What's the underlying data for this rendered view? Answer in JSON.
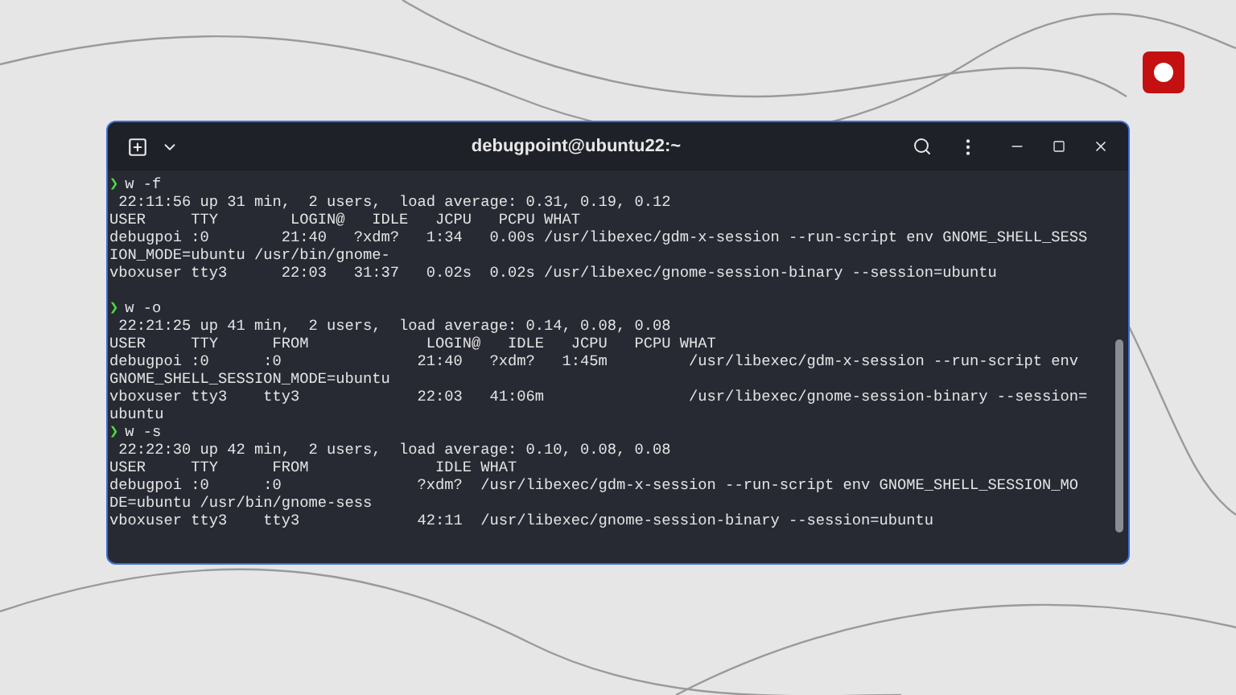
{
  "window": {
    "title": "debugpoint@ubuntu22:~"
  },
  "lines": [
    {
      "kind": "prompt",
      "symbol": "❯",
      "text": "w -f"
    },
    {
      "kind": "output",
      "text": " 22:11:56 up 31 min,  2 users,  load average: 0.31, 0.19, 0.12"
    },
    {
      "kind": "output",
      "text": "USER     TTY        LOGIN@   IDLE   JCPU   PCPU WHAT"
    },
    {
      "kind": "output",
      "text": "debugpoi :0        21:40   ?xdm?   1:34   0.00s /usr/libexec/gdm-x-session --run-script env GNOME_SHELL_SESS"
    },
    {
      "kind": "output",
      "text": "ION_MODE=ubuntu /usr/bin/gnome-"
    },
    {
      "kind": "output",
      "text": "vboxuser tty3      22:03   31:37   0.02s  0.02s /usr/libexec/gnome-session-binary --session=ubuntu"
    },
    {
      "kind": "blank"
    },
    {
      "kind": "prompt",
      "symbol": "❯",
      "text": "w -o"
    },
    {
      "kind": "output",
      "text": " 22:21:25 up 41 min,  2 users,  load average: 0.14, 0.08, 0.08"
    },
    {
      "kind": "output",
      "text": "USER     TTY      FROM             LOGIN@   IDLE   JCPU   PCPU WHAT"
    },
    {
      "kind": "output",
      "text": "debugpoi :0      :0               21:40   ?xdm?   1:45m         /usr/libexec/gdm-x-session --run-script env"
    },
    {
      "kind": "output",
      "text": "GNOME_SHELL_SESSION_MODE=ubuntu"
    },
    {
      "kind": "output",
      "text": "vboxuser tty3    tty3             22:03   41:06m                /usr/libexec/gnome-session-binary --session="
    },
    {
      "kind": "output",
      "text": "ubuntu"
    },
    {
      "kind": "prompt",
      "symbol": "❯",
      "text": "w -s"
    },
    {
      "kind": "output",
      "text": " 22:22:30 up 42 min,  2 users,  load average: 0.10, 0.08, 0.08"
    },
    {
      "kind": "output",
      "text": "USER     TTY      FROM              IDLE WHAT"
    },
    {
      "kind": "output",
      "text": "debugpoi :0      :0               ?xdm?  /usr/libexec/gdm-x-session --run-script env GNOME_SHELL_SESSION_MO"
    },
    {
      "kind": "output",
      "text": "DE=ubuntu /usr/bin/gnome-sess"
    },
    {
      "kind": "output",
      "text": "vboxuser tty3    tty3             42:11  /usr/libexec/gnome-session-binary --session=ubuntu"
    }
  ]
}
